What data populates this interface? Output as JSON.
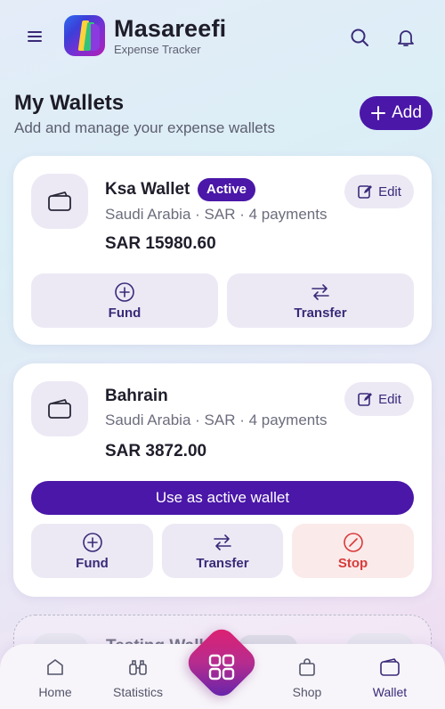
{
  "header": {
    "app_name": "Masareefi",
    "app_subtitle": "Expense Tracker"
  },
  "page": {
    "title": "My Wallets",
    "subtitle": "Add and manage your expense wallets",
    "add_label": "Add"
  },
  "wallets": [
    {
      "name": "Ksa Wallet",
      "badge": "Active",
      "meta": "Saudi Arabia · SAR · 4 payments",
      "balance": "SAR 15980.60",
      "edit_label": "Edit",
      "actions": [
        "Fund",
        "Transfer"
      ]
    },
    {
      "name": "Bahrain",
      "meta": "Saudi Arabia · SAR · 4 payments",
      "balance": "SAR 3872.00",
      "edit_label": "Edit",
      "use_label": "Use as active wallet",
      "actions": [
        "Fund",
        "Transfer",
        "Stop"
      ]
    },
    {
      "name": "Testing Wall"
    }
  ],
  "nav": {
    "items": [
      "Home",
      "Statistics",
      "Shop",
      "Wallet"
    ],
    "active": "Wallet"
  },
  "colors": {
    "primary": "#4a17a8",
    "danger": "#d83a3a",
    "accent_gradient_start": "#e31f6e"
  }
}
